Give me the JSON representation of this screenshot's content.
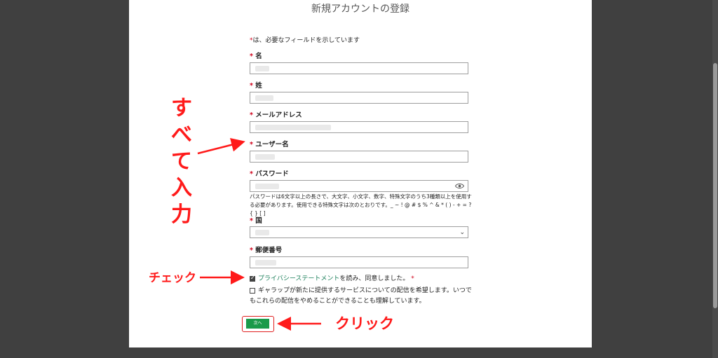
{
  "form": {
    "title": "新規アカウントの登録",
    "required_note_star": "*",
    "required_note": "は、必要なフィールドを示しています",
    "fields": [
      {
        "star": "*",
        "label": "名"
      },
      {
        "star": "*",
        "label": "姓"
      },
      {
        "star": "*",
        "label": "メールアドレス"
      },
      {
        "star": "*",
        "label": "ユーザー名"
      },
      {
        "star": "*",
        "label": "パスワード"
      },
      {
        "star": "*",
        "label": "国"
      },
      {
        "star": "*",
        "label": "郵便番号"
      }
    ],
    "password_help": "パスワードは6文字以上の長さで、大文字、小文字、数字、特殊文字のうち3種類以上を使用する必要があります。使用できる特殊文字は次のとおりです。_ ~ ! @ # $ % ^ & * ( ) - + = ? { } [ ]",
    "privacy_link": "プライバシーステートメント",
    "privacy_text": "を読み、同意しました。",
    "privacy_star": "*",
    "privacy_checked": true,
    "marketing_text": "ギャラップが新たに提供するサービスについての配信を希望します。いつでもこれらの配信をやめることができることも理解しています。",
    "marketing_checked": false,
    "submit_label": "次へ"
  },
  "annotations": {
    "fill_all": "すべて入力",
    "check": "チェック",
    "click": "クリック"
  },
  "colors": {
    "required_star": "#d0021b",
    "link": "#1b7f5a",
    "submit": "#1a9a4a",
    "annotation": "#ff1a1a",
    "backdrop": "#404040"
  },
  "icons": [
    "eye-icon",
    "chevron-down-icon",
    "checkbox-checked-icon",
    "checkbox-empty-icon",
    "arrow-icon"
  ]
}
